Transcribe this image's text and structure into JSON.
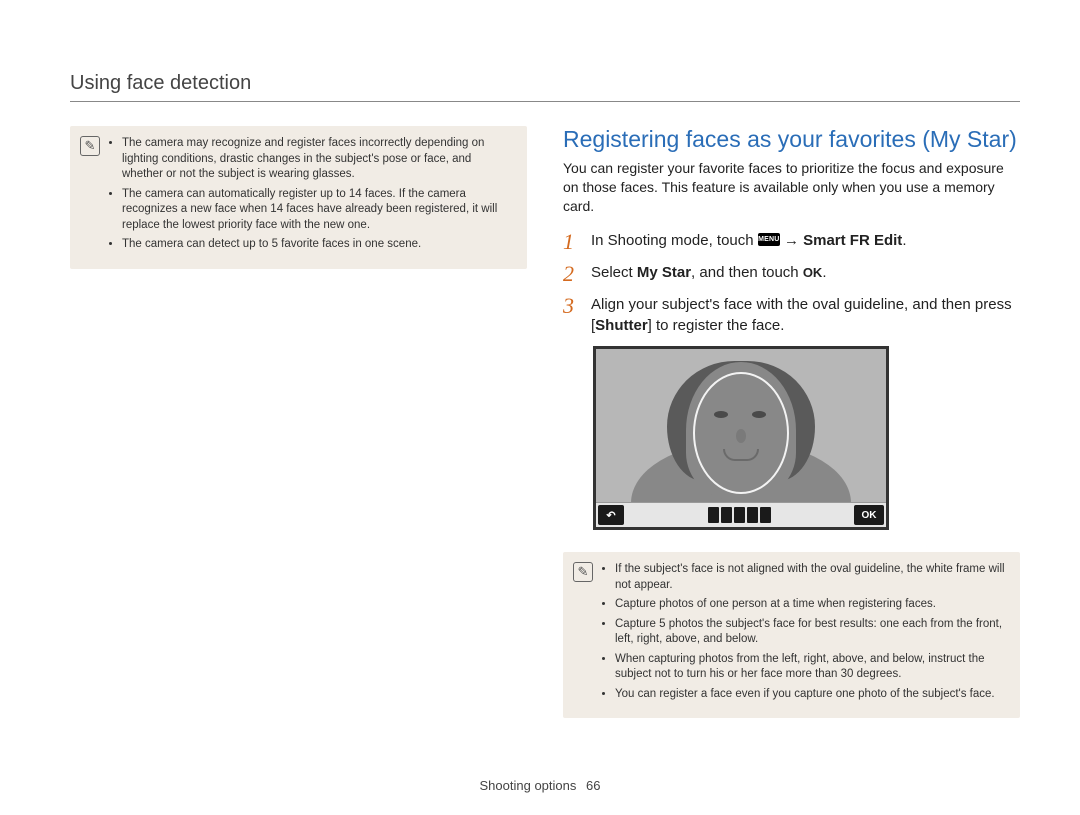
{
  "section_title": "Using face detection",
  "left": {
    "notes": [
      "The camera may recognize and register faces incorrectly depending on lighting conditions, drastic changes in the subject's pose or face, and whether or not the subject is wearing glasses.",
      "The camera can automatically register up to 14 faces. If the camera recognizes a new face when 14 faces have already been registered, it will replace the lowest priority face with the new one.",
      "The camera can detect up to 5 favorite faces in one scene."
    ]
  },
  "right": {
    "heading": "Registering faces as your favorites (My Star)",
    "intro": "You can register your favorite faces to prioritize the focus and exposure on those faces. This feature is available only when you use a memory card.",
    "menu_chip": "MENU",
    "ok_chip": "OK",
    "steps": {
      "s1": {
        "num": "1",
        "pre": "In Shooting mode, touch ",
        "mid": " → ",
        "post": "Smart FR Edit",
        "end": "."
      },
      "s2": {
        "num": "2",
        "pre": "Select ",
        "bold": "My Star",
        "mid": ", and then touch ",
        "end": "."
      },
      "s3": {
        "num": "3",
        "pre": "Align your subject's face with the oval guideline, and then press [",
        "bold": "Shutter",
        "post": "] to register the face."
      }
    },
    "camera": {
      "back_label": "↶",
      "ok_label": "OK"
    },
    "notes": [
      "If the subject's face is not aligned with the oval guideline, the white frame will not appear.",
      "Capture photos of one person at a time when registering faces.",
      "Capture 5 photos the subject's face for best results: one each from the front, left, right, above, and below.",
      "When capturing photos from the left, right, above, and below, instruct the subject not to turn his or her face more than 30 degrees.",
      "You can register a face even if you capture one photo of the subject's face."
    ]
  },
  "footer": {
    "label": "Shooting options",
    "page": "66"
  }
}
